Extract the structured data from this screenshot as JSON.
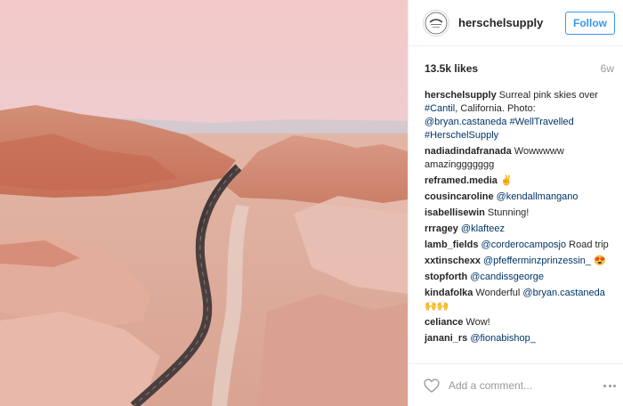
{
  "post": {
    "username": "herschelsupply",
    "follow_label": "Follow",
    "likes": "13.5k likes",
    "age": "6w",
    "add_comment_placeholder": "Add a comment...",
    "photo_alt": "Surreal pink skies over Cantil, California"
  },
  "colors": {
    "link": "#003569",
    "follow": "#3897f0",
    "muted": "#999999"
  },
  "comments": [
    {
      "user": "herschelsupply",
      "parts": [
        {
          "text": "Surreal pink skies over "
        },
        {
          "text": "#Cantil",
          "link": true
        },
        {
          "text": ", California. Photo: "
        },
        {
          "text": "@bryan.castaneda",
          "link": true
        },
        {
          "text": " "
        },
        {
          "text": "#WellTravelled",
          "link": true
        },
        {
          "text": " "
        },
        {
          "text": "#HerschelSupply",
          "link": true
        }
      ]
    },
    {
      "user": "nadiadindafranada",
      "parts": [
        {
          "text": "Wowwwww amazinggggggg"
        }
      ]
    },
    {
      "user": "reframed.media",
      "parts": [
        {
          "text": "✌️"
        }
      ]
    },
    {
      "user": "cousincaroline",
      "parts": [
        {
          "text": "@kendallmangano",
          "link": true
        }
      ]
    },
    {
      "user": "isabellisewin",
      "parts": [
        {
          "text": "Stunning!"
        }
      ]
    },
    {
      "user": "rrragey",
      "parts": [
        {
          "text": "@klafteez",
          "link": true
        }
      ]
    },
    {
      "user": "lamb_fields",
      "parts": [
        {
          "text": "@corderocamposjo",
          "link": true
        },
        {
          "text": " Road trip"
        }
      ]
    },
    {
      "user": "xxtinschexx",
      "parts": [
        {
          "text": "@pfefferminzprinzessin_",
          "link": true
        },
        {
          "text": " 😍"
        }
      ]
    },
    {
      "user": "stopforth",
      "parts": [
        {
          "text": "@candissgeorge",
          "link": true
        }
      ]
    },
    {
      "user": "kindafolka",
      "parts": [
        {
          "text": "Wonderful "
        },
        {
          "text": "@bryan.castaneda",
          "link": true
        },
        {
          "text": " 🙌🙌"
        }
      ]
    },
    {
      "user": "celiance",
      "parts": [
        {
          "text": "Wow!"
        }
      ]
    },
    {
      "user": "janani_rs",
      "parts": [
        {
          "text": "@fionabishop_",
          "link": true
        }
      ]
    }
  ]
}
